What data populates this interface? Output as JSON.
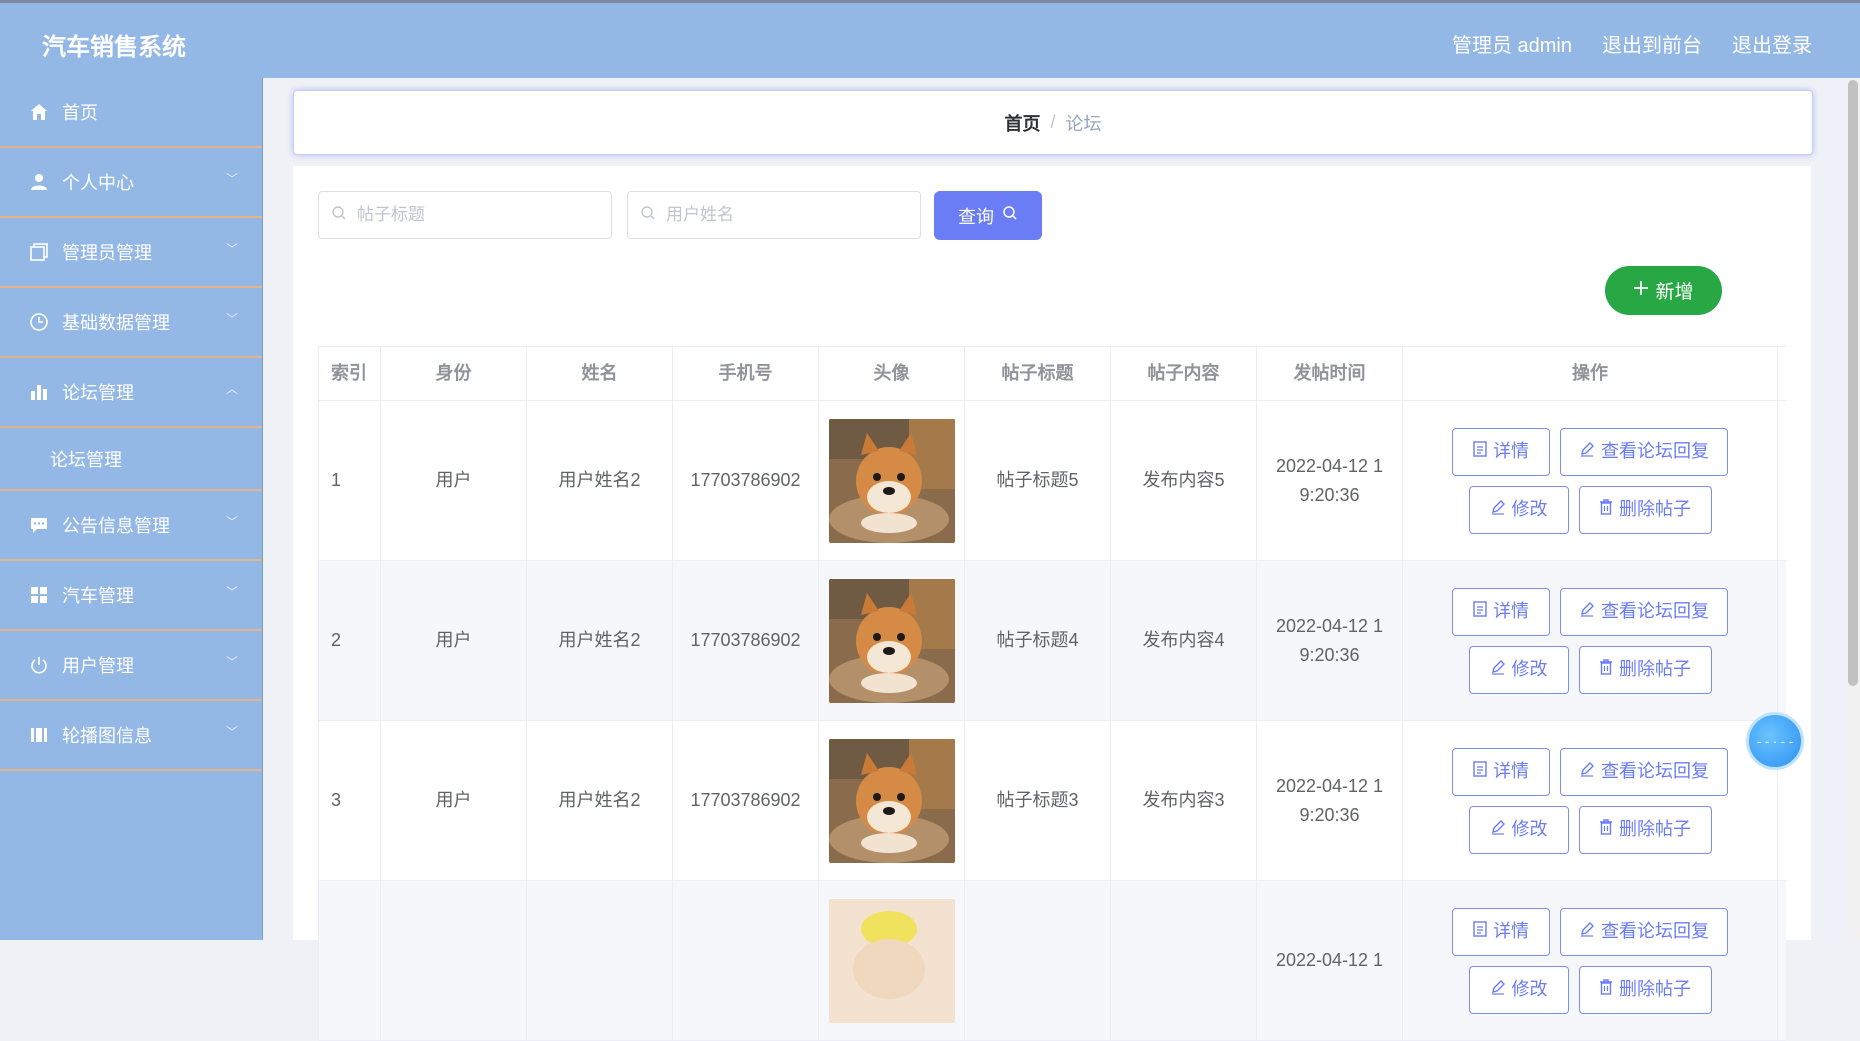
{
  "app": {
    "title": "汽车销售系统"
  },
  "topnav": {
    "admin": "管理员 admin",
    "to_front": "退出到前台",
    "logout": "退出登录"
  },
  "sidebar": {
    "items": [
      {
        "label": "首页",
        "icon": "home-icon"
      },
      {
        "label": "个人中心",
        "icon": "user-icon"
      },
      {
        "label": "管理员管理",
        "icon": "copy-icon"
      },
      {
        "label": "基础数据管理",
        "icon": "clock-icon"
      },
      {
        "label": "论坛管理",
        "icon": "chart-icon",
        "expanded": true
      },
      {
        "label": "公告信息管理",
        "icon": "message-icon"
      },
      {
        "label": "汽车管理",
        "icon": "grid-icon"
      },
      {
        "label": "用户管理",
        "icon": "power-icon"
      },
      {
        "label": "轮播图信息",
        "icon": "film-icon"
      }
    ],
    "submenu": {
      "label": "论坛管理"
    }
  },
  "breadcrumb": {
    "home": "首页",
    "sep": "/",
    "current": "论坛"
  },
  "search": {
    "title_placeholder": "帖子标题",
    "name_placeholder": "用户姓名",
    "query_label": "查询",
    "add_label": "新增"
  },
  "table": {
    "headers": [
      "索引",
      "身份",
      "姓名",
      "手机号",
      "头像",
      "帖子标题",
      "帖子内容",
      "发帖时间",
      "操作"
    ],
    "rows": [
      {
        "index": "1",
        "role": "用户",
        "name": "用户姓名2",
        "phone": "17703786902",
        "title": "帖子标题5",
        "content": "发布内容5",
        "time_a": "2022-04-12 1",
        "time_b": "9:20:36"
      },
      {
        "index": "2",
        "role": "用户",
        "name": "用户姓名2",
        "phone": "17703786902",
        "title": "帖子标题4",
        "content": "发布内容4",
        "time_a": "2022-04-12 1",
        "time_b": "9:20:36"
      },
      {
        "index": "3",
        "role": "用户",
        "name": "用户姓名2",
        "phone": "17703786902",
        "title": "帖子标题3",
        "content": "发布内容3",
        "time_a": "2022-04-12 1",
        "time_b": "9:20:36"
      },
      {
        "index": "",
        "role": "",
        "name": "",
        "phone": "",
        "title": "",
        "content": "",
        "time_a": "2022-04-12 1",
        "time_b": ""
      }
    ],
    "actions": {
      "detail": "详情",
      "view_reply": "查看论坛回复",
      "edit": "修改",
      "delete": "删除帖子"
    }
  },
  "colors": {
    "topbar": "#94b8e6",
    "primary": "#6a7df5",
    "success": "#27a844",
    "divider": "#e3b38a"
  }
}
